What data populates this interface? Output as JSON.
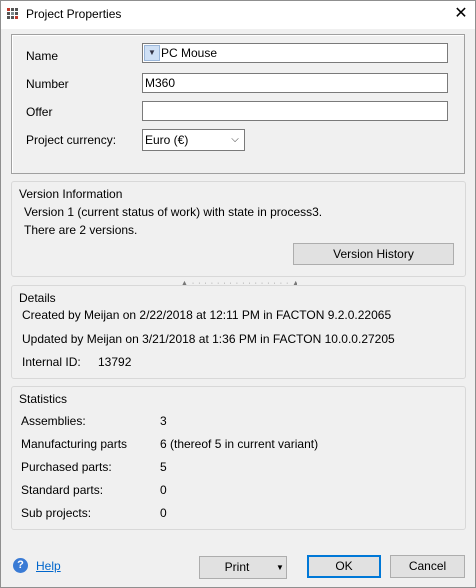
{
  "window": {
    "title": "Project Properties",
    "close_glyph": "✕"
  },
  "form": {
    "name_label": "Name",
    "name_value": "PC Mouse",
    "number_label": "Number",
    "number_value": "M360",
    "offer_label": "Offer",
    "offer_value": "",
    "currency_label": "Project currency:",
    "currency_value": "Euro (€)"
  },
  "version": {
    "title": "Version Information",
    "line1": "Version 1 (current status of work) with state in process3.",
    "line2": "There are 2 versions.",
    "history_button": "Version History"
  },
  "details": {
    "title": "Details",
    "created": "Created by Meijan on 2/22/2018 at 12:11 PM in FACTON 9.2.0.22065",
    "updated": "Updated by Meijan on 3/21/2018 at 1:36 PM in FACTON 10.0.0.27205",
    "internal_id_label": "Internal ID:",
    "internal_id_value": "13792"
  },
  "statistics": {
    "title": "Statistics",
    "rows": [
      {
        "label": "Assemblies:",
        "value": "3"
      },
      {
        "label": "Manufacturing parts",
        "value": "6 (thereof 5 in current variant)"
      },
      {
        "label": "Purchased parts:",
        "value": "5"
      },
      {
        "label": "Standard parts:",
        "value": "0"
      },
      {
        "label": "Sub projects:",
        "value": "0"
      }
    ]
  },
  "footer": {
    "help": "Help",
    "print": "Print",
    "ok": "OK",
    "cancel": "Cancel"
  },
  "icons": {
    "app": "grid-icon",
    "help": "question-icon",
    "dropdown": "chevron-down-icon"
  }
}
